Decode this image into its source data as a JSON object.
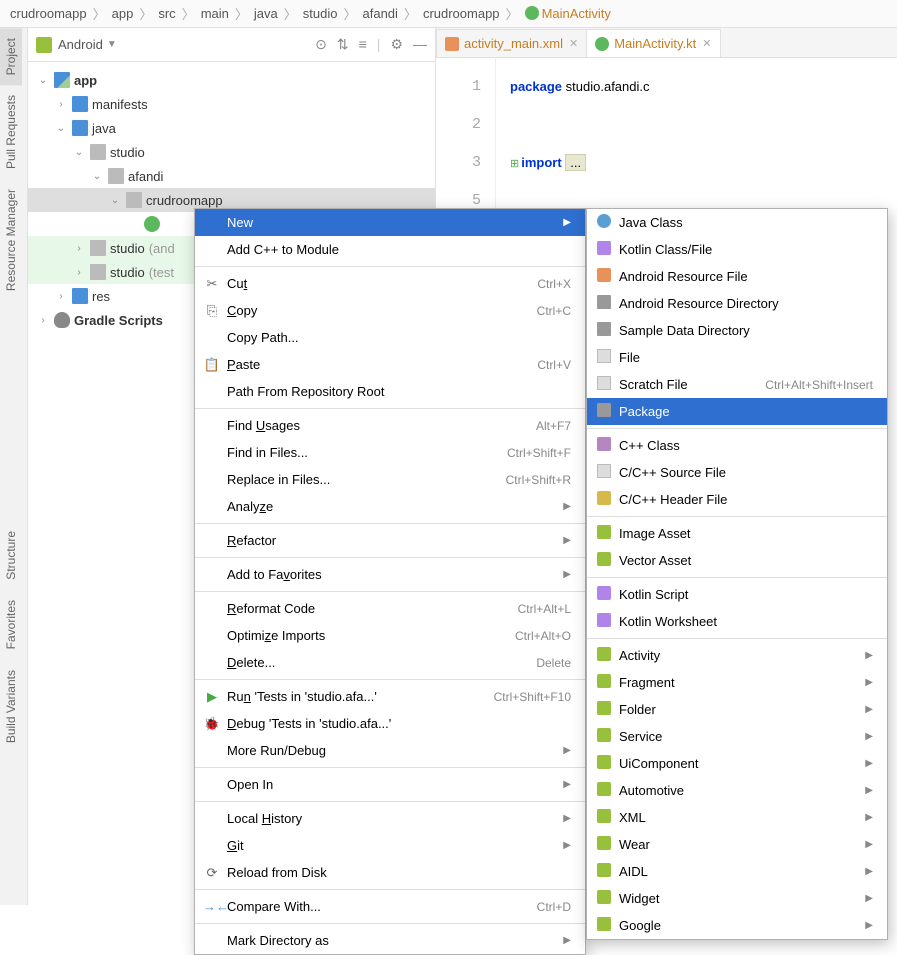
{
  "breadcrumb": [
    "crudroomapp",
    "app",
    "src",
    "main",
    "java",
    "studio",
    "afandi",
    "crudroomapp",
    "MainActivity"
  ],
  "sidebar_tabs": {
    "project": "Project",
    "pull": "Pull Requests",
    "resmgr": "Resource Manager",
    "struct": "Structure",
    "fav": "Favorites",
    "build": "Build Variants"
  },
  "panel": {
    "title": "Android"
  },
  "tree": {
    "app": "app",
    "manifests": "manifests",
    "java": "java",
    "studio": "studio",
    "afandi": "afandi",
    "crudroomapp": "crudroomapp",
    "studio_and": "studio",
    "studio_and_suf": "(and",
    "studio_test": "studio",
    "studio_test_suf": "(test",
    "res": "res",
    "gradle": "Gradle Scripts"
  },
  "tabs": {
    "xml": "activity_main.xml",
    "kt": "MainActivity.kt"
  },
  "code": {
    "l1a": "package",
    "l1b": " studio.afandi.c",
    "l3a": "import",
    "l3b": "..."
  },
  "ctx1": [
    {
      "label": "New",
      "sel": true,
      "sub": true
    },
    {
      "label": "Add C++ to Module"
    },
    {
      "sep": true
    },
    {
      "icon": "✂",
      "label": "Cut",
      "ul": "t",
      "sc": "Ctrl+X"
    },
    {
      "icon": "⎘",
      "label": "Copy",
      "ul": "C",
      "sc": "Ctrl+C"
    },
    {
      "label": "Copy Path..."
    },
    {
      "icon": "📋",
      "label": "Paste",
      "ul": "P",
      "sc": "Ctrl+V"
    },
    {
      "label": "Path From Repository Root"
    },
    {
      "sep": true
    },
    {
      "label": "Find Usages",
      "ul": "U",
      "sc": "Alt+F7"
    },
    {
      "label": "Find in Files...",
      "sc": "Ctrl+Shift+F"
    },
    {
      "label": "Replace in Files...",
      "sc": "Ctrl+Shift+R"
    },
    {
      "label": "Analyze",
      "ul": "z",
      "sub": true
    },
    {
      "sep": true
    },
    {
      "label": "Refactor",
      "ul": "R",
      "sub": true
    },
    {
      "sep": true
    },
    {
      "label": "Add to Favorites",
      "ul": "v",
      "sub": true
    },
    {
      "sep": true
    },
    {
      "label": "Reformat Code",
      "ul": "R",
      "sc": "Ctrl+Alt+L"
    },
    {
      "label": "Optimize Imports",
      "ul": "z",
      "sc": "Ctrl+Alt+O"
    },
    {
      "label": "Delete...",
      "ul": "D",
      "sc": "Delete"
    },
    {
      "sep": true
    },
    {
      "icon": "▶",
      "iconColor": "#4a4",
      "label": "Run 'Tests in 'studio.afa...'",
      "ul": "n",
      "sc": "Ctrl+Shift+F10"
    },
    {
      "icon": "🐞",
      "iconColor": "#4a4",
      "label": "Debug 'Tests in 'studio.afa...'",
      "ul": "D"
    },
    {
      "label": "More Run/Debug",
      "sub": true
    },
    {
      "sep": true
    },
    {
      "label": "Open In",
      "sub": true
    },
    {
      "sep": true
    },
    {
      "label": "Local History",
      "ul": "H",
      "sub": true
    },
    {
      "label": "Git",
      "ul": "G",
      "sub": true
    },
    {
      "icon": "⟳",
      "label": "Reload from Disk"
    },
    {
      "sep": true
    },
    {
      "icon": "→←",
      "iconColor": "#4a90d9",
      "label": "Compare With...",
      "sc": "Ctrl+D"
    },
    {
      "sep": true
    },
    {
      "label": "Mark Directory as",
      "sub": true
    }
  ],
  "ctx2": [
    {
      "ico": "ico-java",
      "label": "Java Class"
    },
    {
      "ico": "ico-kotlin",
      "label": "Kotlin Class/File"
    },
    {
      "ico": "ico-xml",
      "label": "Android Resource File"
    },
    {
      "ico": "ico-folder",
      "label": "Android Resource Directory"
    },
    {
      "ico": "ico-folder",
      "label": "Sample Data Directory"
    },
    {
      "ico": "ico-file",
      "label": "File"
    },
    {
      "ico": "ico-file",
      "label": "Scratch File",
      "sc": "Ctrl+Alt+Shift+Insert"
    },
    {
      "ico": "ico-folder",
      "label": "Package",
      "sel": true
    },
    {
      "sep": true
    },
    {
      "ico": "ico-purple",
      "label": "C++ Class"
    },
    {
      "ico": "ico-file",
      "label": "C/C++ Source File"
    },
    {
      "ico": "ico-yellow",
      "label": "C/C++ Header File"
    },
    {
      "sep": true
    },
    {
      "ico": "ico-android",
      "label": "Image Asset"
    },
    {
      "ico": "ico-android",
      "label": "Vector Asset"
    },
    {
      "sep": true
    },
    {
      "ico": "ico-kotlin",
      "label": "Kotlin Script"
    },
    {
      "ico": "ico-kotlin",
      "label": "Kotlin Worksheet"
    },
    {
      "sep": true
    },
    {
      "ico": "ico-android",
      "label": "Activity",
      "sub": true
    },
    {
      "ico": "ico-android",
      "label": "Fragment",
      "sub": true
    },
    {
      "ico": "ico-android",
      "label": "Folder",
      "sub": true
    },
    {
      "ico": "ico-android",
      "label": "Service",
      "sub": true
    },
    {
      "ico": "ico-android",
      "label": "UiComponent",
      "sub": true
    },
    {
      "ico": "ico-android",
      "label": "Automotive",
      "sub": true
    },
    {
      "ico": "ico-android",
      "label": "XML",
      "sub": true
    },
    {
      "ico": "ico-android",
      "label": "Wear",
      "sub": true
    },
    {
      "ico": "ico-android",
      "label": "AIDL",
      "sub": true
    },
    {
      "ico": "ico-android",
      "label": "Widget",
      "sub": true
    },
    {
      "ico": "ico-android",
      "label": "Google",
      "sub": true
    }
  ]
}
